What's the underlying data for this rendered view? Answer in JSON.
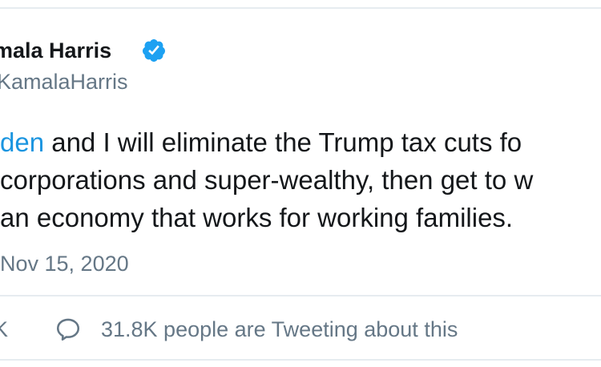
{
  "tweet": {
    "author_name": "mala Harris",
    "handle": "KamalaHarris",
    "verified_icon": "verified-badge-icon",
    "body": {
      "mention": "den",
      "line1_rest": " and I will eliminate the Trump tax cuts fo",
      "line2": "corporations and super-wealthy, then get to w",
      "line3": "an economy that works for working families."
    },
    "timestamp": "Nov 15, 2020"
  },
  "engagement": {
    "left_fragment": "K",
    "reply_icon": "speech-bubble-icon",
    "tweeting_text": "31.8K people are Tweeting about this"
  },
  "colors": {
    "text": "#14171a",
    "secondary": "#657786",
    "link": "#1b95e0",
    "verified": "#1da1f2",
    "divider": "#e6ecf0"
  }
}
